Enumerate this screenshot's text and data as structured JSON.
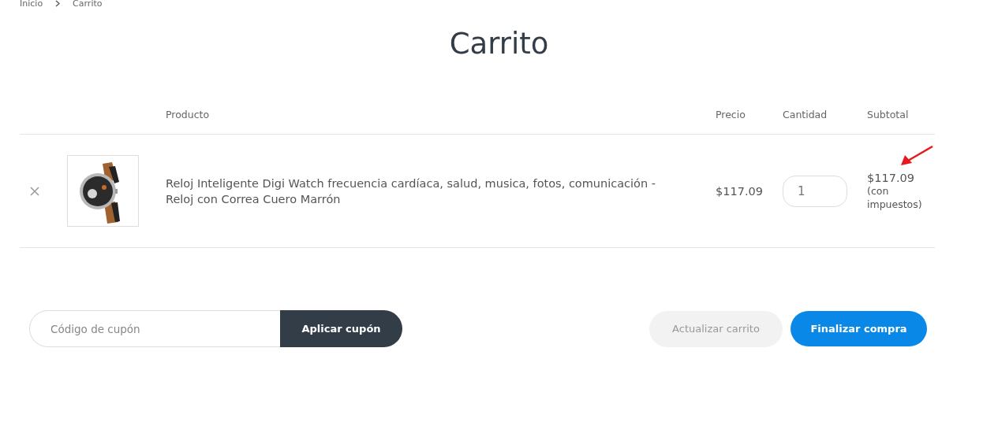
{
  "breadcrumb": [
    "Inicio",
    "Carrito"
  ],
  "title": "Carrito",
  "table": {
    "columns": [
      "Producto",
      "Precio",
      "Cantidad",
      "Subtotal"
    ],
    "rows": [
      {
        "kind": "picture",
        "name": "Reloj Inteligente Digi Watch frecuencia cardíaca, salud, musica, fotos, comunicación - Reloj con Correa Cuero Marrón",
        "price": "$117.09",
        "quantity": "1",
        "subtotal": "$117.09",
        "tax_note": "(con impuestos)"
      }
    ]
  },
  "coupon": {
    "placeholder": "Código de cupón",
    "button": "Aplicar cupón"
  },
  "actions": [
    {
      "label": "Actualizar carrito",
      "disabled": true,
      "kind": "secondary"
    },
    {
      "label": "Finalizar compra",
      "disabled": false,
      "kind": "primary"
    }
  ]
}
